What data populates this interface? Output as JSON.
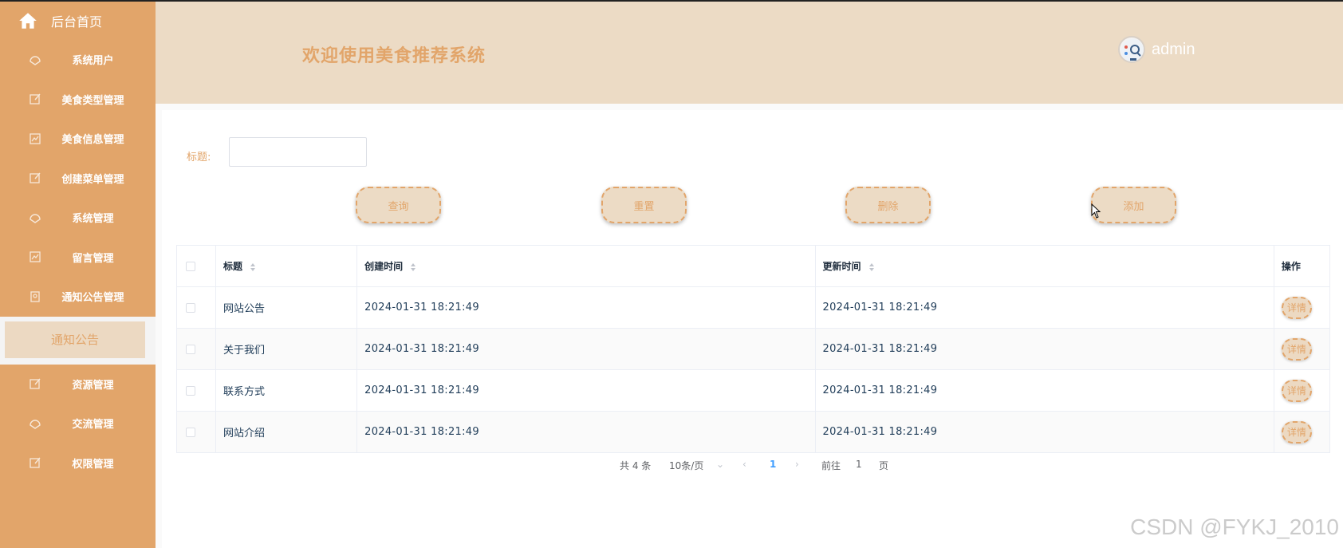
{
  "sidebar": {
    "home_label": "后台首页",
    "items": [
      {
        "label": "系统用户",
        "icon": "dashboard-icon"
      },
      {
        "label": "美食类型管理",
        "icon": "edit-icon"
      },
      {
        "label": "美食信息管理",
        "icon": "chart-icon"
      },
      {
        "label": "创建菜单管理",
        "icon": "edit-icon"
      },
      {
        "label": "系统管理",
        "icon": "dashboard-icon"
      },
      {
        "label": "留言管理",
        "icon": "chart-icon"
      },
      {
        "label": "通知公告管理",
        "icon": "bookmark-icon"
      }
    ],
    "active_sub": "通知公告",
    "items_after": [
      {
        "label": "资源管理",
        "icon": "edit-icon"
      },
      {
        "label": "交流管理",
        "icon": "dashboard-icon"
      },
      {
        "label": "权限管理",
        "icon": "edit-icon"
      }
    ]
  },
  "header": {
    "title": "欢迎使用美食推荐系统",
    "username": "admin"
  },
  "search": {
    "label": "标题:",
    "value": ""
  },
  "buttons": {
    "query": "查询",
    "reset": "重置",
    "delete": "删除",
    "add": "添加"
  },
  "table": {
    "headers": {
      "title": "标题",
      "created": "创建时间",
      "updated": "更新时间",
      "actions": "操作"
    },
    "rows": [
      {
        "title": "网站公告",
        "created": "2024-01-31 18:21:49",
        "updated": "2024-01-31 18:21:49",
        "action": "详情"
      },
      {
        "title": "关于我们",
        "created": "2024-01-31 18:21:49",
        "updated": "2024-01-31 18:21:49",
        "action": "详情"
      },
      {
        "title": "联系方式",
        "created": "2024-01-31 18:21:49",
        "updated": "2024-01-31 18:21:49",
        "action": "详情"
      },
      {
        "title": "网站介绍",
        "created": "2024-01-31 18:21:49",
        "updated": "2024-01-31 18:21:49",
        "action": "详情"
      }
    ]
  },
  "pagination": {
    "total": "共 4 条",
    "page_size": "10条/页",
    "current_page": "1",
    "goto_label": "前往",
    "goto_value": "1",
    "page_suffix": "页"
  },
  "watermark": "CSDN @FYKJ_2010",
  "colors": {
    "sidebar": "#e2a56a",
    "header": "#ecdbc5",
    "accent": "#e2a56a"
  }
}
